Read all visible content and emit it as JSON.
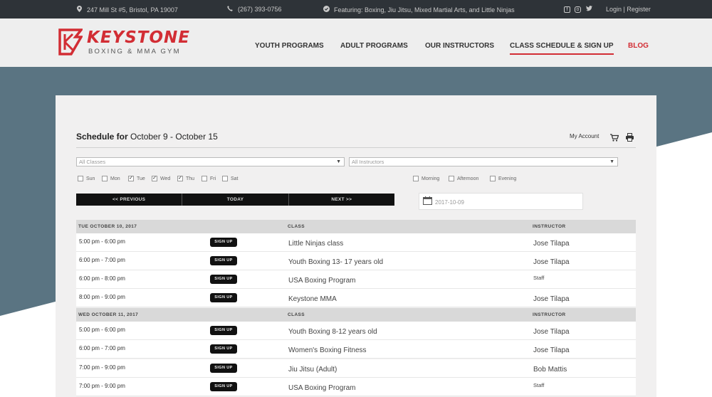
{
  "topbar": {
    "address": "247 Mill St #5, Bristol, PA 19007",
    "phone": "(267) 393-0756",
    "featuring": "Featuring: Boxing, Jiu Jitsu, Mixed Martial Arts, and Little Ninjas",
    "social": [
      "facebook-icon",
      "instagram-icon",
      "twitter-icon"
    ],
    "login_register": "Login | Register"
  },
  "logo": {
    "title": "KEYSTONE",
    "subtitle": "BOXING & MMA GYM"
  },
  "nav": {
    "youth": "YOUTH PROGRAMS",
    "adult": "ADULT PROGRAMS",
    "instructors": "OUR INSTRUCTORS",
    "schedule": "CLASS SCHEDULE & SIGN UP",
    "blog": "BLOG"
  },
  "colors": {
    "accent": "#d22d34",
    "slate": "#5a7482",
    "topbar": "#2e3338"
  },
  "schedule": {
    "title_prefix": "Schedule for",
    "title_range": "October 9 - October 15",
    "my_account": "My Account",
    "class_filter": "All Classes",
    "instructor_filter": "All Instructors",
    "days": [
      {
        "label": "Sun",
        "checked": false
      },
      {
        "label": "Mon",
        "checked": false
      },
      {
        "label": "Tue",
        "checked": true
      },
      {
        "label": "Wed",
        "checked": true
      },
      {
        "label": "Thu",
        "checked": true
      },
      {
        "label": "Fri",
        "checked": false
      },
      {
        "label": "Sat",
        "checked": false
      }
    ],
    "times": [
      {
        "label": "Morning",
        "checked": false
      },
      {
        "label": "Afternoon",
        "checked": false
      },
      {
        "label": "Evening",
        "checked": false
      }
    ],
    "prev": "<< PREVIOUS",
    "today": "TODAY",
    "next": "NEXT >>",
    "date_value": "2017-10-09",
    "sign_up": "SIGN UP",
    "col_class": "CLASS",
    "col_instructor": "INSTRUCTOR",
    "days_list": [
      {
        "heading": "TUE OCTOBER 10, 2017",
        "rows": [
          {
            "time": "5:00 pm - 6:00 pm",
            "class": "Little Ninjas class",
            "instructor": "Jose Tilapa"
          },
          {
            "time": "6:00 pm - 7:00 pm",
            "class": "Youth Boxing 13- 17 years old",
            "instructor": "Jose Tilapa"
          },
          {
            "time": "6:00 pm - 8:00 pm",
            "class": "USA Boxing Program",
            "instructor": "Staff"
          },
          {
            "time": "8:00 pm - 9:00 pm",
            "class": "Keystone MMA",
            "instructor": "Jose Tilapa"
          }
        ]
      },
      {
        "heading": "WED OCTOBER 11, 2017",
        "rows": [
          {
            "time": "5:00 pm - 6:00 pm",
            "class": "Youth Boxing 8-12 years old",
            "instructor": "Jose Tilapa"
          },
          {
            "time": "6:00 pm - 7:00 pm",
            "class": "Women's Boxing Fitness",
            "instructor": "Jose Tilapa"
          },
          {
            "time": "7:00 pm - 9:00 pm",
            "class": "Jiu Jitsu (Adult)",
            "instructor": "Bob Mattis"
          },
          {
            "time": "7:00 pm - 9:00 pm",
            "class": "USA Boxing Program",
            "instructor": "Staff"
          }
        ]
      }
    ]
  }
}
